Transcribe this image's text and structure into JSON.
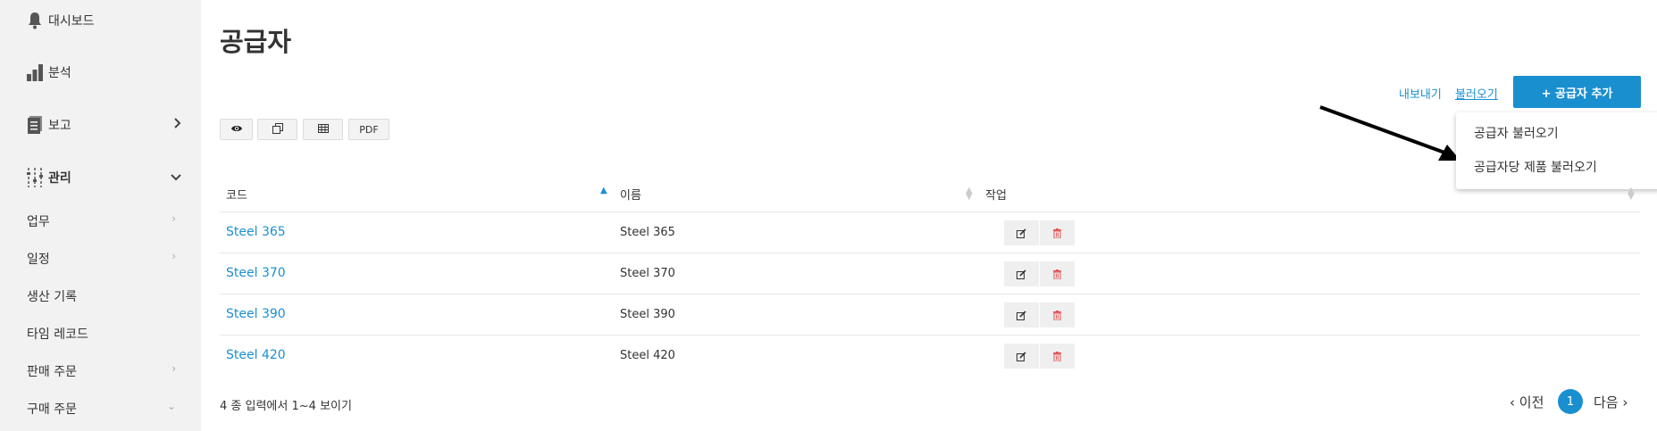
{
  "sidebar": {
    "items": [
      {
        "label": "대시보드",
        "icon": "bell-icon"
      },
      {
        "label": "분석",
        "icon": "bar-chart-icon"
      },
      {
        "label": "보고",
        "icon": "report-icon"
      },
      {
        "label": "관리",
        "icon": "sliders-icon"
      }
    ],
    "subitems": [
      {
        "label": "업무"
      },
      {
        "label": "일정"
      },
      {
        "label": "생산 기록"
      },
      {
        "label": "타임 레코드"
      },
      {
        "label": "판매 주문"
      },
      {
        "label": "구매 주문"
      }
    ]
  },
  "page": {
    "title": "공급자"
  },
  "toolbar": {
    "buttons": [
      {
        "icon": "eye-icon"
      },
      {
        "icon": "copy-icon"
      },
      {
        "icon": "table-icon"
      },
      {
        "label": "PDF"
      }
    ]
  },
  "header_actions": {
    "export_label": "내보내기",
    "import_label": "불러오기",
    "add_label": "+ 공급자 추가"
  },
  "dropdown": {
    "items": [
      {
        "label": "공급자 불러오기"
      },
      {
        "label": "공급자당 제품 불러오기"
      }
    ]
  },
  "table": {
    "columns": [
      {
        "label": "코드"
      },
      {
        "label": "이름"
      },
      {
        "label": "작업"
      }
    ],
    "rows": [
      {
        "code": "Steel 365",
        "name": "Steel 365"
      },
      {
        "code": "Steel 370",
        "name": "Steel 370"
      },
      {
        "code": "Steel 390",
        "name": "Steel 390"
      },
      {
        "code": "Steel 420",
        "name": "Steel 420"
      }
    ]
  },
  "footer": {
    "summary": "4 종 입력에서 1~4 보이기",
    "prev_label": "‹ 이전",
    "current_page": "1",
    "next_label": "다음 ›"
  },
  "colors": {
    "accent": "#1a8fd0",
    "sidebar_bg": "#f2f2f2",
    "delete": "#e05555"
  }
}
